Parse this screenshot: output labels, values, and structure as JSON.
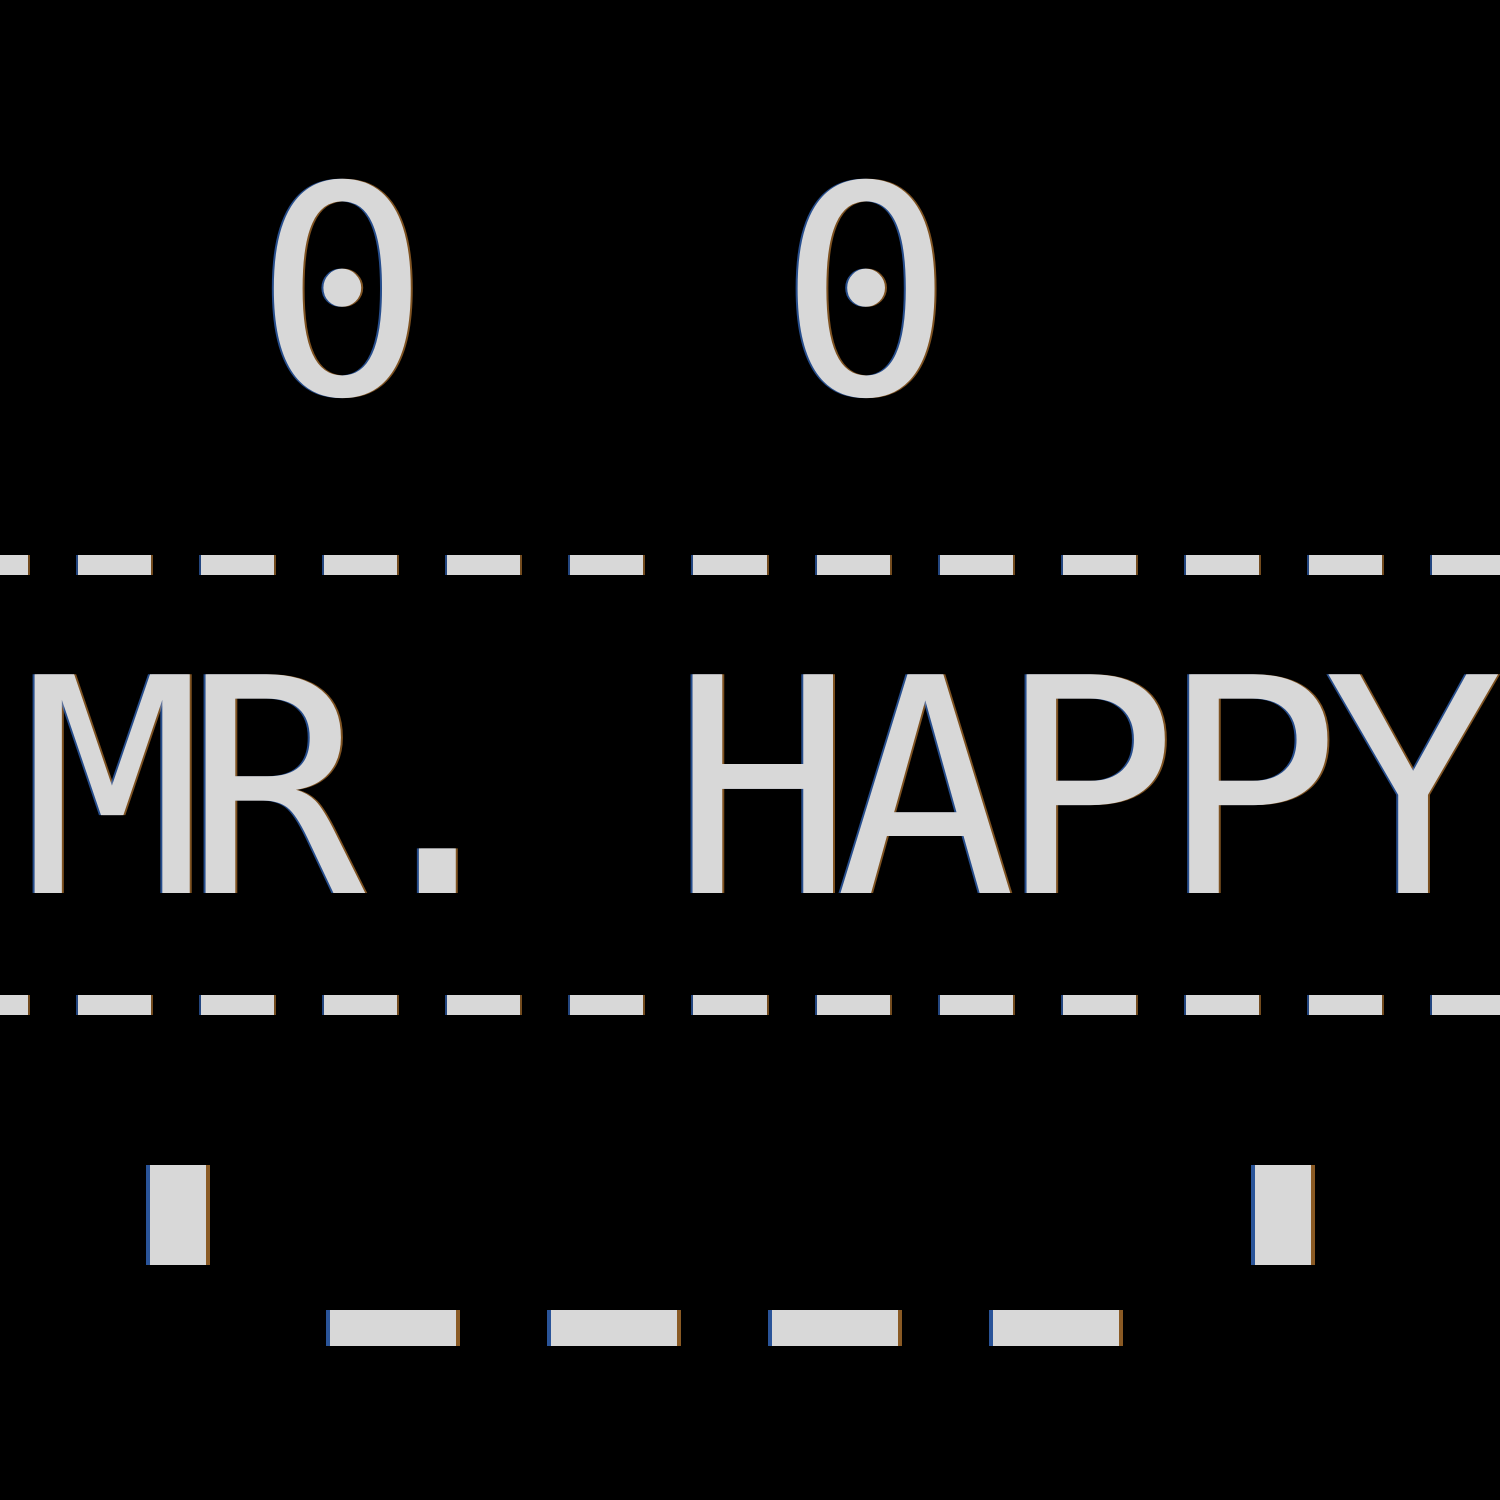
{
  "terminal": {
    "eyes_text": "0  0",
    "top_rule_text": "------------",
    "name_text": "MR. HAPPY",
    "bottom_rule_text": "------------",
    "mouth_left": "'",
    "mouth_right": "'",
    "mouth_text": "____"
  },
  "colors": {
    "background": "#000000",
    "text": "#d8d8d8"
  }
}
